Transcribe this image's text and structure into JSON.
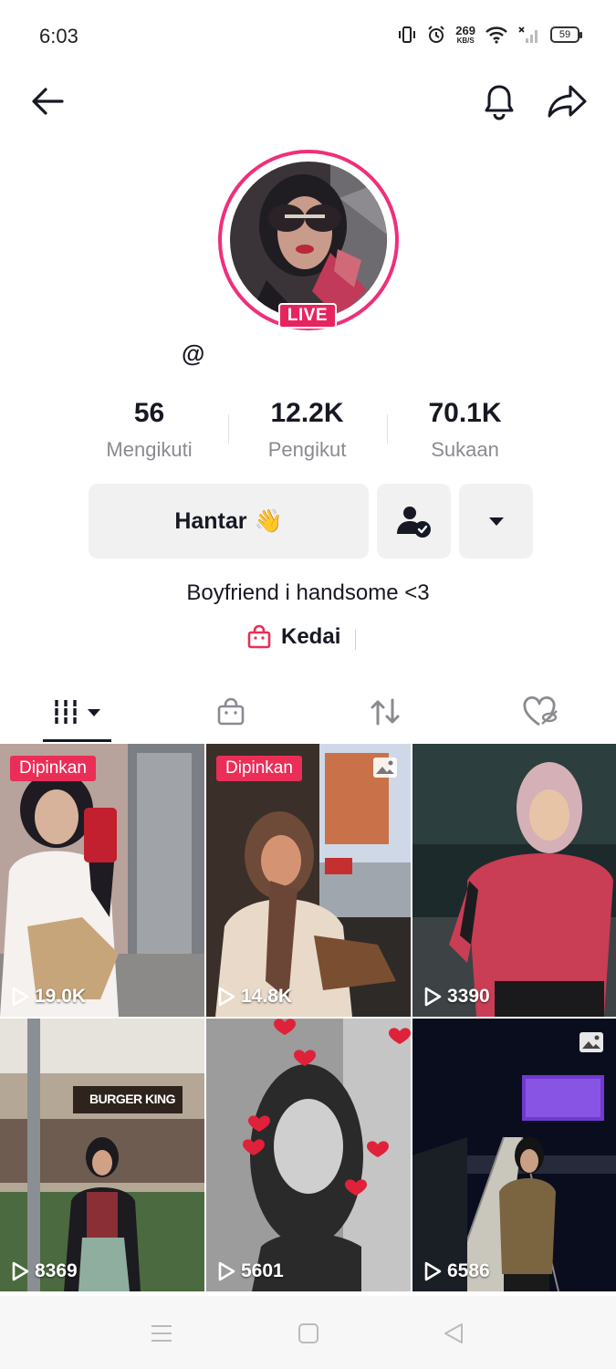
{
  "status_bar": {
    "time": "6:03",
    "net_speed": "269",
    "net_unit": "KB/S",
    "battery": "59"
  },
  "header": {
    "title": "",
    "back_icon": "arrow-left-icon",
    "bell_icon": "bell-icon",
    "share_icon": "share-arrow-icon"
  },
  "profile": {
    "username": "@",
    "live_label": "LIVE",
    "accent": "#ef2f7b"
  },
  "stats": [
    {
      "value": "56",
      "label": "Mengikuti"
    },
    {
      "value": "12.2K",
      "label": "Pengikut"
    },
    {
      "value": "70.1K",
      "label": "Sukaan"
    }
  ],
  "actions": {
    "message_label": "Hantar",
    "message_emoji": "👋",
    "follow_icon": "user-check-icon",
    "more_icon": "caret-down-icon"
  },
  "bio": "Boyfriend i handsome <3",
  "shop": {
    "label": "Kedai",
    "icon": "shopping-bag-icon"
  },
  "tabs": [
    {
      "name": "videos",
      "icon": "grid-icon",
      "active": true
    },
    {
      "name": "shop",
      "icon": "shopping-bag-icon",
      "active": false
    },
    {
      "name": "repost",
      "icon": "repost-icon",
      "active": false
    },
    {
      "name": "liked",
      "icon": "heart-lock-icon",
      "active": false
    }
  ],
  "videos": [
    {
      "views": "19.0K",
      "pinned": "Dipinkan",
      "photo": false
    },
    {
      "views": "14.8K",
      "pinned": "Dipinkan",
      "photo": true
    },
    {
      "views": "3390",
      "pinned": "",
      "photo": false
    },
    {
      "views": "8369",
      "pinned": "",
      "photo": false
    },
    {
      "views": "5601",
      "pinned": "",
      "photo": false
    },
    {
      "views": "6586",
      "pinned": "",
      "photo": true
    }
  ],
  "tile3_sign": "BURGER KING",
  "colors": {
    "pin_badge": "#ea2e57",
    "live_badge": "#e8245f",
    "button_bg": "#f1f1f2",
    "shop_icon": "#ea2e57"
  }
}
